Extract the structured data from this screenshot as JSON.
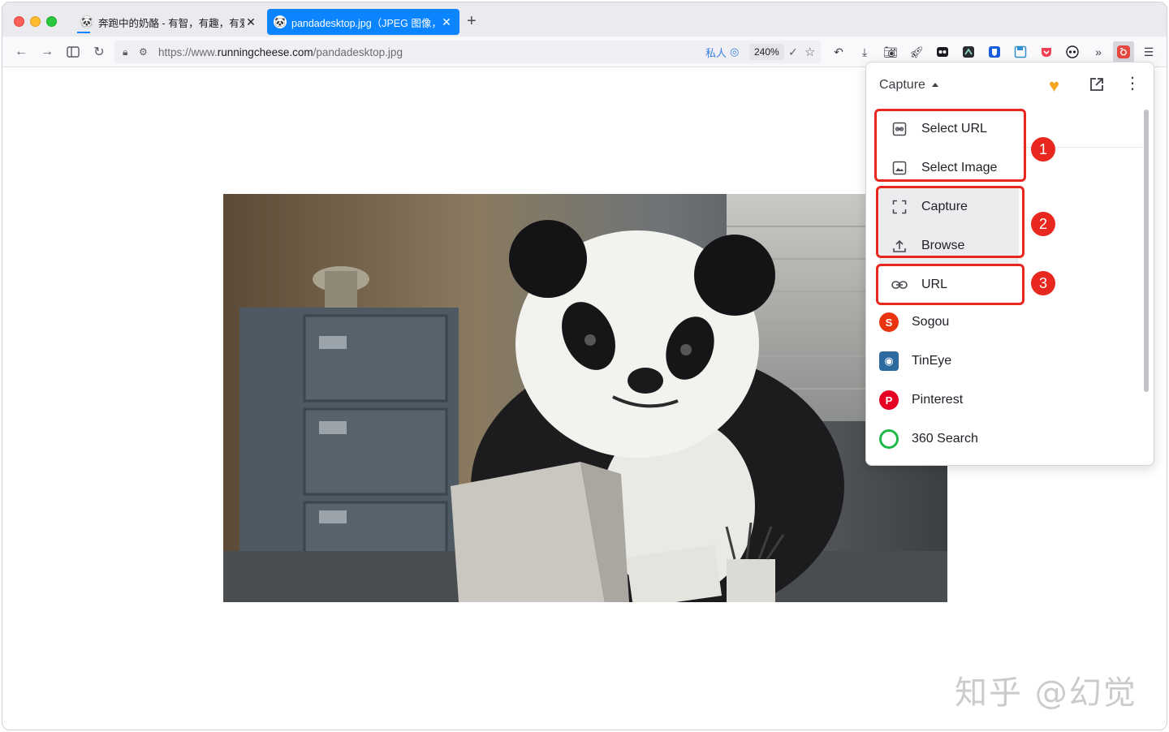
{
  "tabs": [
    {
      "title": "奔跑中的奶酪 - 有智，有趣，有爱",
      "active": false
    },
    {
      "title": "pandadesktop.jpg（JPEG 图像，",
      "active": true
    }
  ],
  "toolbar": {
    "url_prefix": "https://www.",
    "url_domain": "runningcheese.com",
    "url_path": "/pandadesktop.jpg",
    "private_label": "私人",
    "zoom": "240%"
  },
  "popup": {
    "selected_engine": "Capture",
    "menu_items": [
      {
        "label": "Select URL",
        "icon": "link-box-icon"
      },
      {
        "label": "Select Image",
        "icon": "image-icon"
      },
      {
        "label": "Capture",
        "icon": "capture-frame-icon"
      },
      {
        "label": "Browse",
        "icon": "upload-icon"
      },
      {
        "label": "URL",
        "icon": "link-icon"
      }
    ],
    "engines": [
      {
        "label": "Sogou",
        "color": "#e8340f"
      },
      {
        "label": "TinEye",
        "color": "#2c6aa0"
      },
      {
        "label": "Pinterest",
        "color": "#e60023"
      },
      {
        "label": "360 Search",
        "color": "#1fb94a"
      }
    ]
  },
  "annotations": [
    "1",
    "2",
    "3"
  ],
  "watermark": "知乎 @幻觉"
}
